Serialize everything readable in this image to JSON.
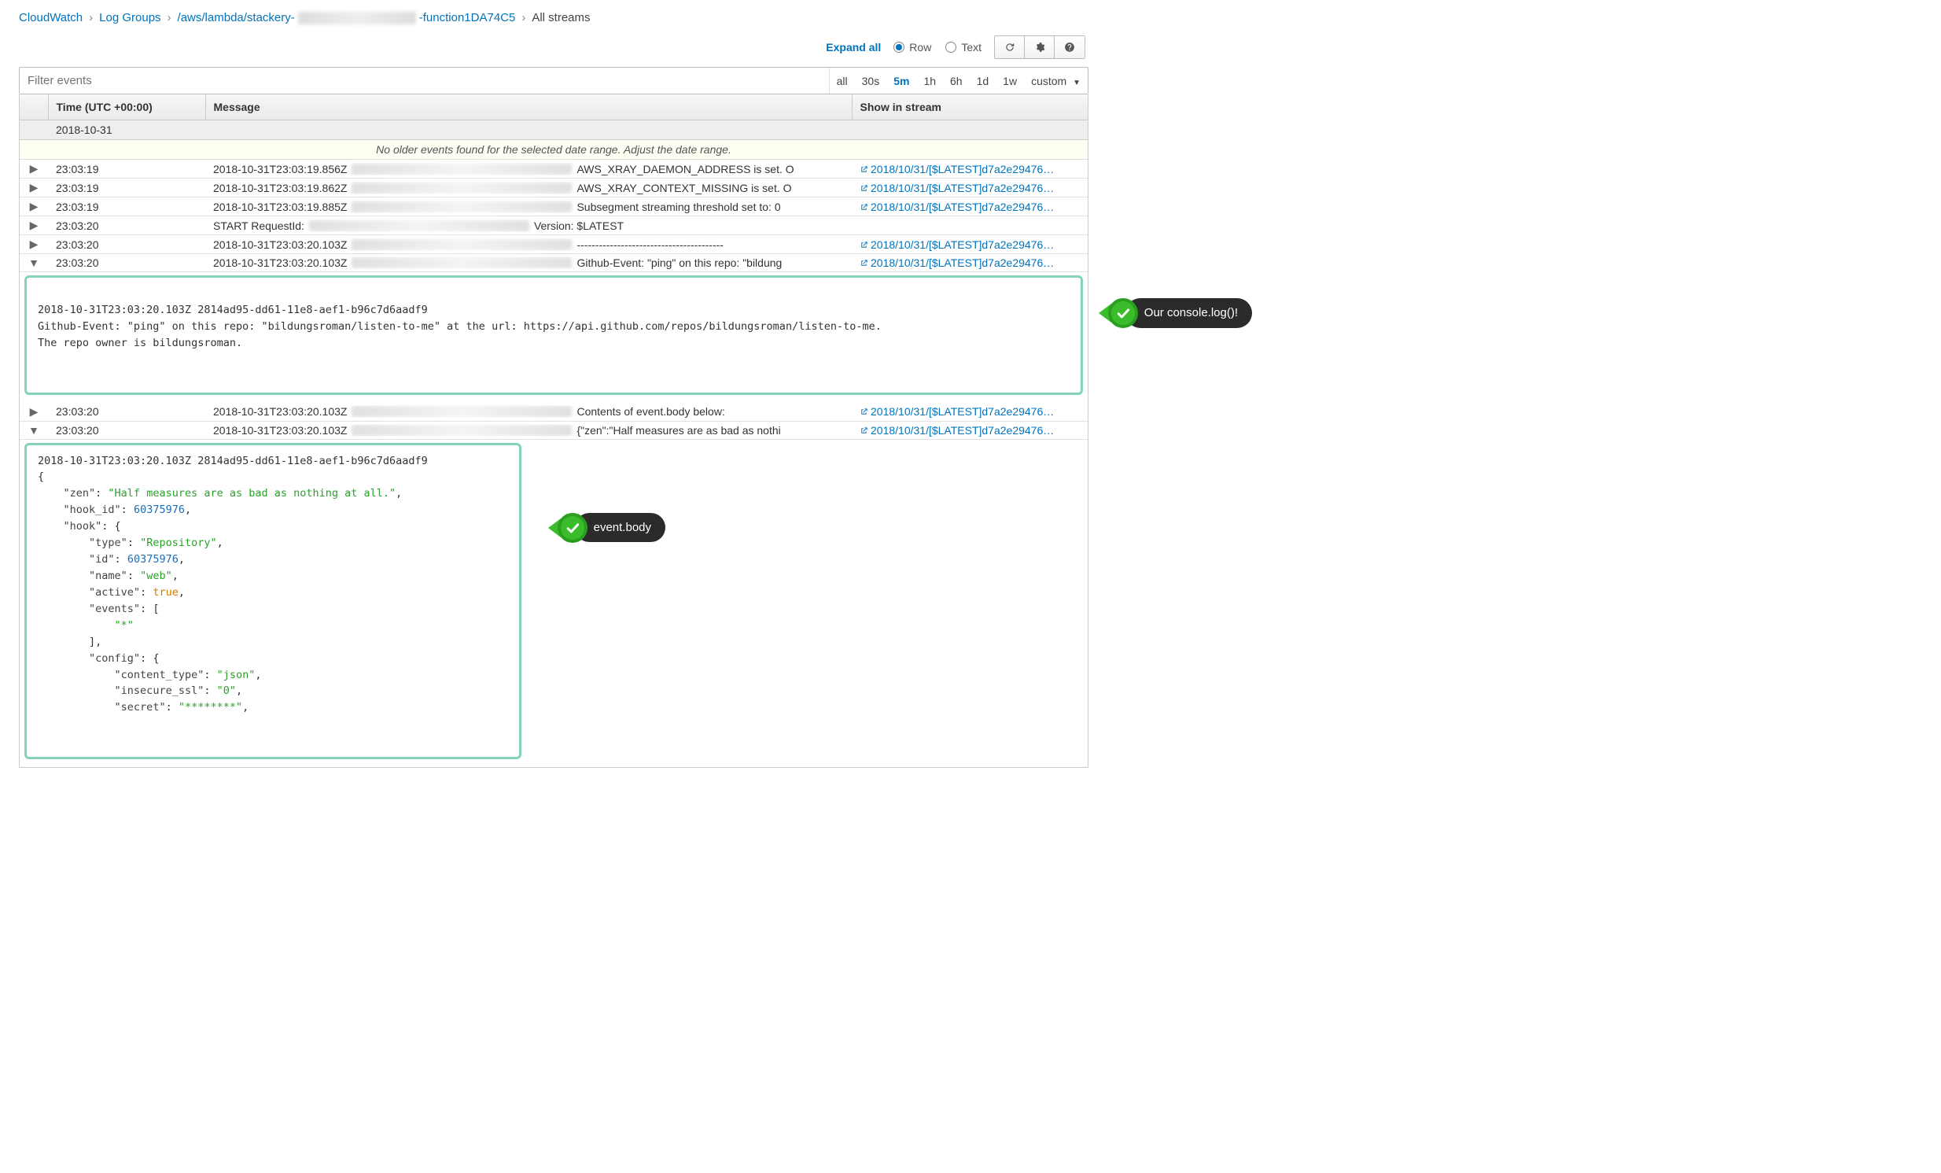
{
  "breadcrumb": {
    "l1": "CloudWatch",
    "l2": "Log Groups",
    "l3_prefix": "/aws/lambda/stackery-",
    "l3_suffix": "-function1DA74C5",
    "l4": "All streams"
  },
  "toolbar": {
    "expand_all": "Expand all",
    "radio_row": "Row",
    "radio_text": "Text"
  },
  "filter": {
    "placeholder": "Filter events"
  },
  "time_ranges": {
    "all": "all",
    "r30s": "30s",
    "r5m": "5m",
    "r1h": "1h",
    "r6h": "6h",
    "r1d": "1d",
    "r1w": "1w",
    "custom": "custom",
    "active": "5m"
  },
  "columns": {
    "time": "Time (UTC +00:00)",
    "message": "Message",
    "stream": "Show in stream"
  },
  "date_header": "2018-10-31",
  "no_older": "No older events found for the selected date range. Adjust the date range.",
  "stream_link": "2018/10/31/[$LATEST]d7a2e29476…",
  "events": [
    {
      "expanded": false,
      "time": "23:03:19",
      "ts": "2018-10-31T23:03:19.856Z",
      "tail": "AWS_XRAY_DAEMON_ADDRESS is set. O",
      "has_stream": true
    },
    {
      "expanded": false,
      "time": "23:03:19",
      "ts": "2018-10-31T23:03:19.862Z",
      "tail": "AWS_XRAY_CONTEXT_MISSING is set. O",
      "has_stream": true
    },
    {
      "expanded": false,
      "time": "23:03:19",
      "ts": "2018-10-31T23:03:19.885Z",
      "tail": "Subsegment streaming threshold set to: 0",
      "has_stream": true
    },
    {
      "expanded": false,
      "time": "23:03:20",
      "ts": "START RequestId:",
      "tail": "Version: $LATEST",
      "blur_width": 280,
      "has_stream": false
    },
    {
      "expanded": false,
      "time": "23:03:20",
      "ts": "2018-10-31T23:03:20.103Z",
      "tail": "----------------------------------------",
      "has_stream": true
    },
    {
      "expanded": true,
      "time": "23:03:20",
      "ts": "2018-10-31T23:03:20.103Z",
      "tail": "Github-Event: \"ping\" on this repo: \"bildung",
      "has_stream": true,
      "panel": "p1"
    },
    {
      "expanded": false,
      "time": "23:03:20",
      "ts": "2018-10-31T23:03:20.103Z",
      "tail": "Contents of event.body below:",
      "has_stream": true
    },
    {
      "expanded": true,
      "time": "23:03:20",
      "ts": "2018-10-31T23:03:20.103Z",
      "tail": "{\"zen\":\"Half measures are as bad as nothi",
      "has_stream": true,
      "panel": "p2"
    }
  ],
  "panel1": {
    "line1": "2018-10-31T23:03:20.103Z 2814ad95-dd61-11e8-aef1-b96c7d6aadf9",
    "line2": "Github-Event: \"ping\" on this repo: \"bildungsroman/listen-to-me\" at the url: https://api.github.com/repos/bildungsroman/listen-to-me.",
    "line3": "The repo owner is bildungsroman."
  },
  "callouts": {
    "c1": "Our console.log()!",
    "c2": "event.body"
  },
  "panel2": {
    "header": "2018-10-31T23:03:20.103Z 2814ad95-dd61-11e8-aef1-b96c7d6aadf9",
    "json": {
      "zen": "Half measures are as bad as nothing at all.",
      "hook_id": 60375976,
      "hook_type": "Repository",
      "hook_idnum": 60375976,
      "hook_name": "web",
      "hook_active": "true",
      "events_star": "*",
      "content_type": "json",
      "insecure_ssl": "0",
      "secret": "********"
    }
  }
}
